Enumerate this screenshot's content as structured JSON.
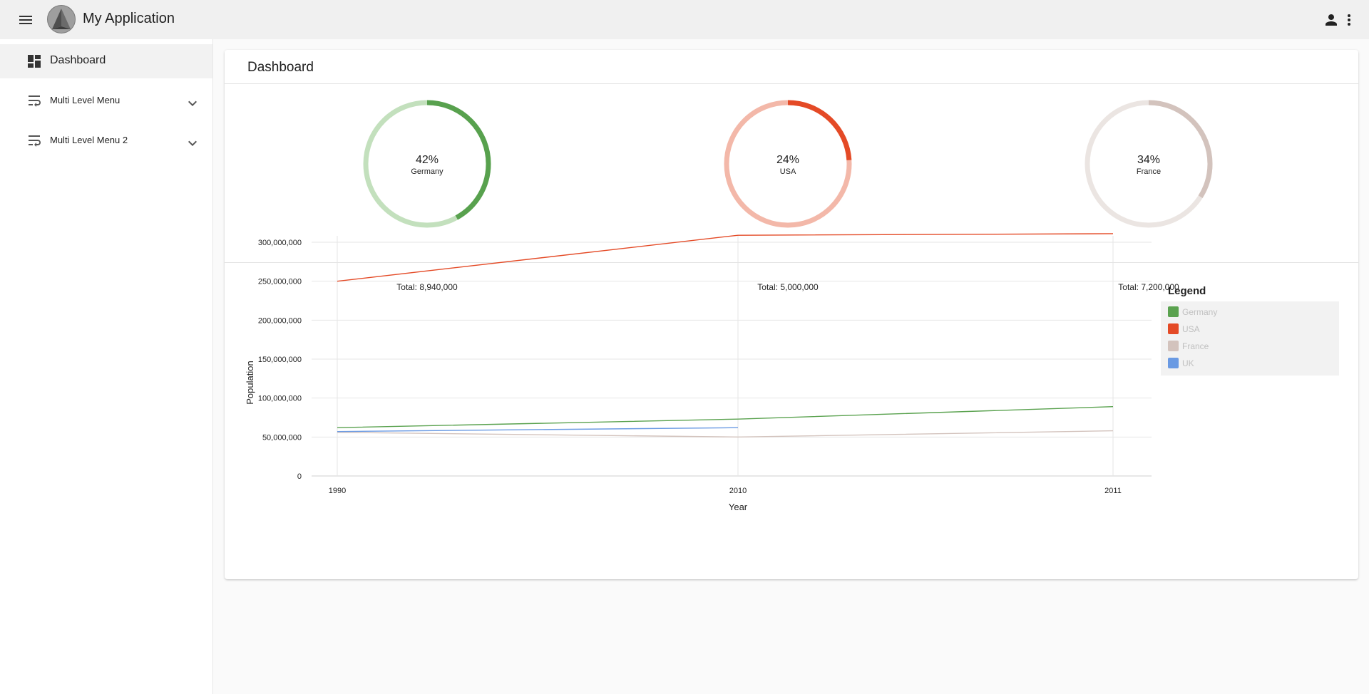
{
  "header": {
    "app_title": "My Application",
    "icons": [
      "menu-icon",
      "logo-icon",
      "person-icon",
      "more-vert-icon"
    ]
  },
  "sidebar": {
    "items": [
      {
        "label": "Dashboard",
        "icon": "dashboard-icon"
      },
      {
        "label": "Multi Level Menu",
        "icon": "wrap-text-icon"
      },
      {
        "label": "Multi Level Menu 2",
        "icon": "wrap-text-icon"
      }
    ]
  },
  "main": {
    "title": "Dashboard",
    "donuts": [
      {
        "percent": "42%",
        "name": "Germany",
        "total": "Total: 8,940,000",
        "value": 0.42,
        "color": "#58a14e",
        "track": "#c3e0bd"
      },
      {
        "percent": "24%",
        "name": "USA",
        "total": "Total: 5,000,000",
        "value": 0.24,
        "color": "#e44a26",
        "track": "#f3b8a9"
      },
      {
        "percent": "34%",
        "name": "France",
        "total": "Total: 7,200,000",
        "value": 0.34,
        "color": "#d3c3bd",
        "track": "#ebe5e2"
      }
    ]
  },
  "chart_data": {
    "type": "line",
    "title": "",
    "xlabel": "Year",
    "ylabel": "Population",
    "categories": [
      "1990",
      "2010",
      "2011"
    ],
    "ylim": [
      0,
      300000000
    ],
    "yticks": [
      "0",
      "50,000,000",
      "100,000,000",
      "150,000,000",
      "200,000,000",
      "250,000,000",
      "300,000,000"
    ],
    "grid": true,
    "legend_title": "Legend",
    "legend_position": "right",
    "series": [
      {
        "name": "Germany",
        "color": "#5aa24f",
        "values": [
          62000000,
          73000000,
          89000000
        ]
      },
      {
        "name": "USA",
        "color": "#e44a26",
        "values": [
          250000000,
          309000000,
          311000000
        ]
      },
      {
        "name": "France",
        "color": "#d3c3bd",
        "values": [
          56000000,
          50000000,
          58000000
        ]
      },
      {
        "name": "UK",
        "color": "#6a9ae3",
        "values": [
          57000000,
          62000000,
          null
        ]
      }
    ]
  }
}
